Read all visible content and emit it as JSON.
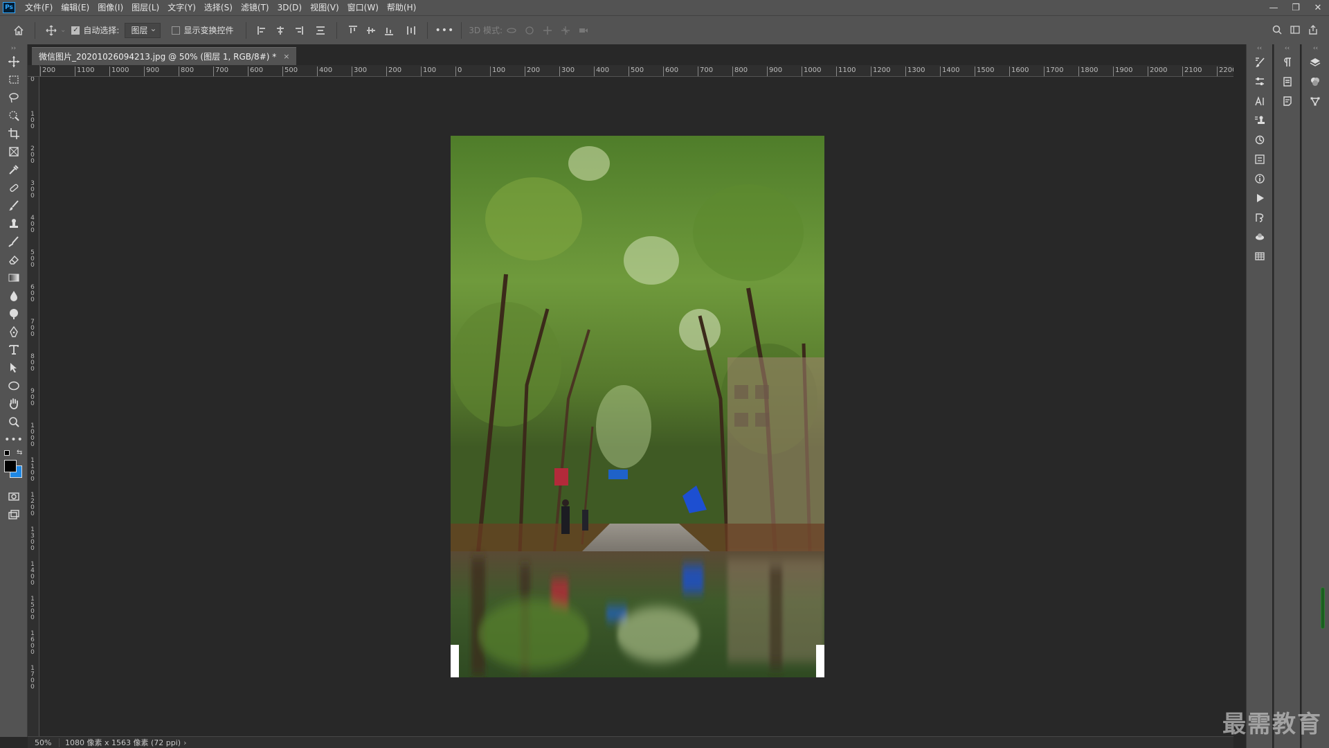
{
  "app": {
    "logo": "Ps",
    "menu": [
      "文件(F)",
      "编辑(E)",
      "图像(I)",
      "图层(L)",
      "文字(Y)",
      "选择(S)",
      "滤镜(T)",
      "3D(D)",
      "视图(V)",
      "窗口(W)",
      "帮助(H)"
    ],
    "window_controls": [
      "minimize-icon",
      "restore-icon",
      "close-icon"
    ]
  },
  "options": {
    "auto_select_label": "自动选择:",
    "auto_select_checked": true,
    "layer_select_value": "图层",
    "show_transform_label": "显示变换控件",
    "show_transform_checked": false,
    "more": "•••",
    "mode_3d_label": "3D 模式:"
  },
  "document": {
    "tab_title": "微信图片_20201026094213.jpg @ 50% (图层 1, RGB/8#) *",
    "close": "×"
  },
  "ruler_top": [
    "200",
    "1100",
    "1000",
    "900",
    "800",
    "700",
    "600",
    "500",
    "400",
    "300",
    "200",
    "100",
    "0",
    "100",
    "200",
    "300",
    "400",
    "500",
    "600",
    "700",
    "800",
    "900",
    "1000",
    "1100",
    "1200",
    "1300",
    "1400",
    "1500",
    "1600",
    "1700",
    "1800",
    "1900",
    "2000",
    "2100",
    "2200"
  ],
  "ruler_left": [
    "0",
    "1 0 0",
    "2 0 0",
    "3 0 0",
    "4 0 0",
    "5 0 0",
    "6 0 0",
    "7 0 0",
    "8 0 0",
    "9 0 0",
    "1 0 0 0",
    "1 1 0 0",
    "1 2 0 0",
    "1 3 0 0",
    "1 4 0 0",
    "1 5 0 0",
    "1 6 0 0",
    "1 7 0 0"
  ],
  "status": {
    "zoom": "50%",
    "info": "1080 像素 x 1563 像素 (72 ppi)"
  },
  "watermark": "最需教育",
  "colors": {
    "foreground": "#000000",
    "background": "#1e88e5",
    "accent": "#31a8ff"
  }
}
